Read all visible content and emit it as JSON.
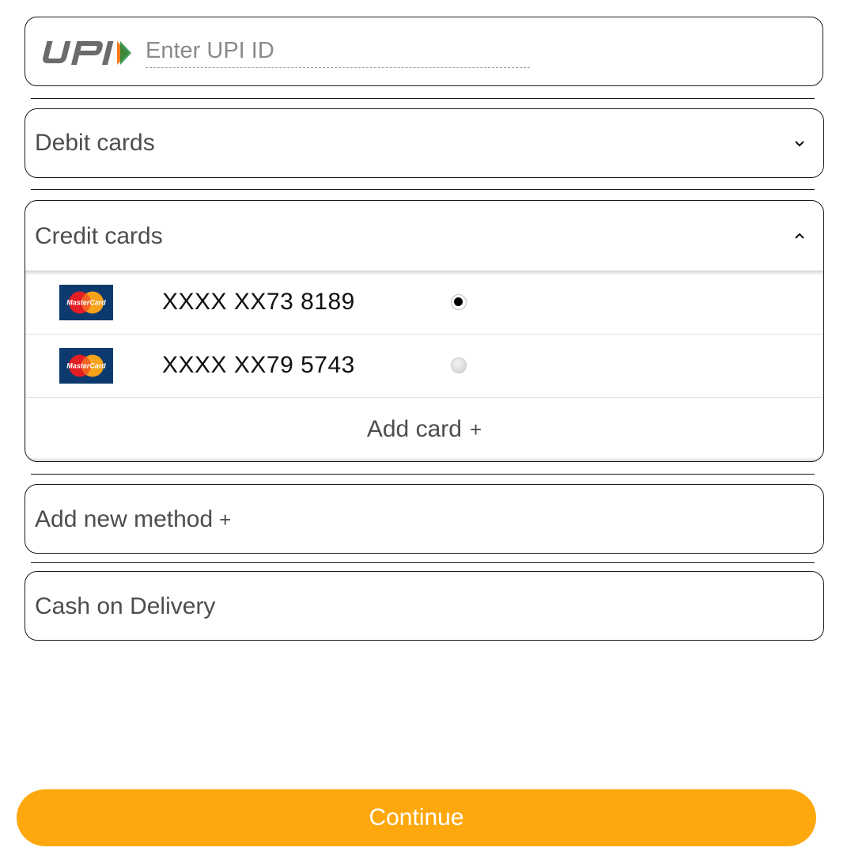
{
  "upi": {
    "logo_text": "UPI",
    "placeholder": "Enter UPI ID",
    "value": ""
  },
  "debit": {
    "label": "Debit cards",
    "chevron": "chevron-down-icon"
  },
  "credit": {
    "label": "Credit cards",
    "chevron": "chevron-up-icon",
    "cards": [
      {
        "brand": "MasterCard",
        "number": "XXXX XX73 8189",
        "selected": true
      },
      {
        "brand": "MasterCard",
        "number": "XXXX XX79 5743",
        "selected": false
      }
    ],
    "add_card_label": "Add card",
    "add_card_icon": "+"
  },
  "add_new_method": {
    "label": "Add new method",
    "icon": "+"
  },
  "cod": {
    "label": "Cash on Delivery"
  },
  "continue": {
    "label": "Continue"
  },
  "colors": {
    "accent": "#fea80d",
    "border": "#1a1a1a",
    "text": "#4d4d4d"
  }
}
